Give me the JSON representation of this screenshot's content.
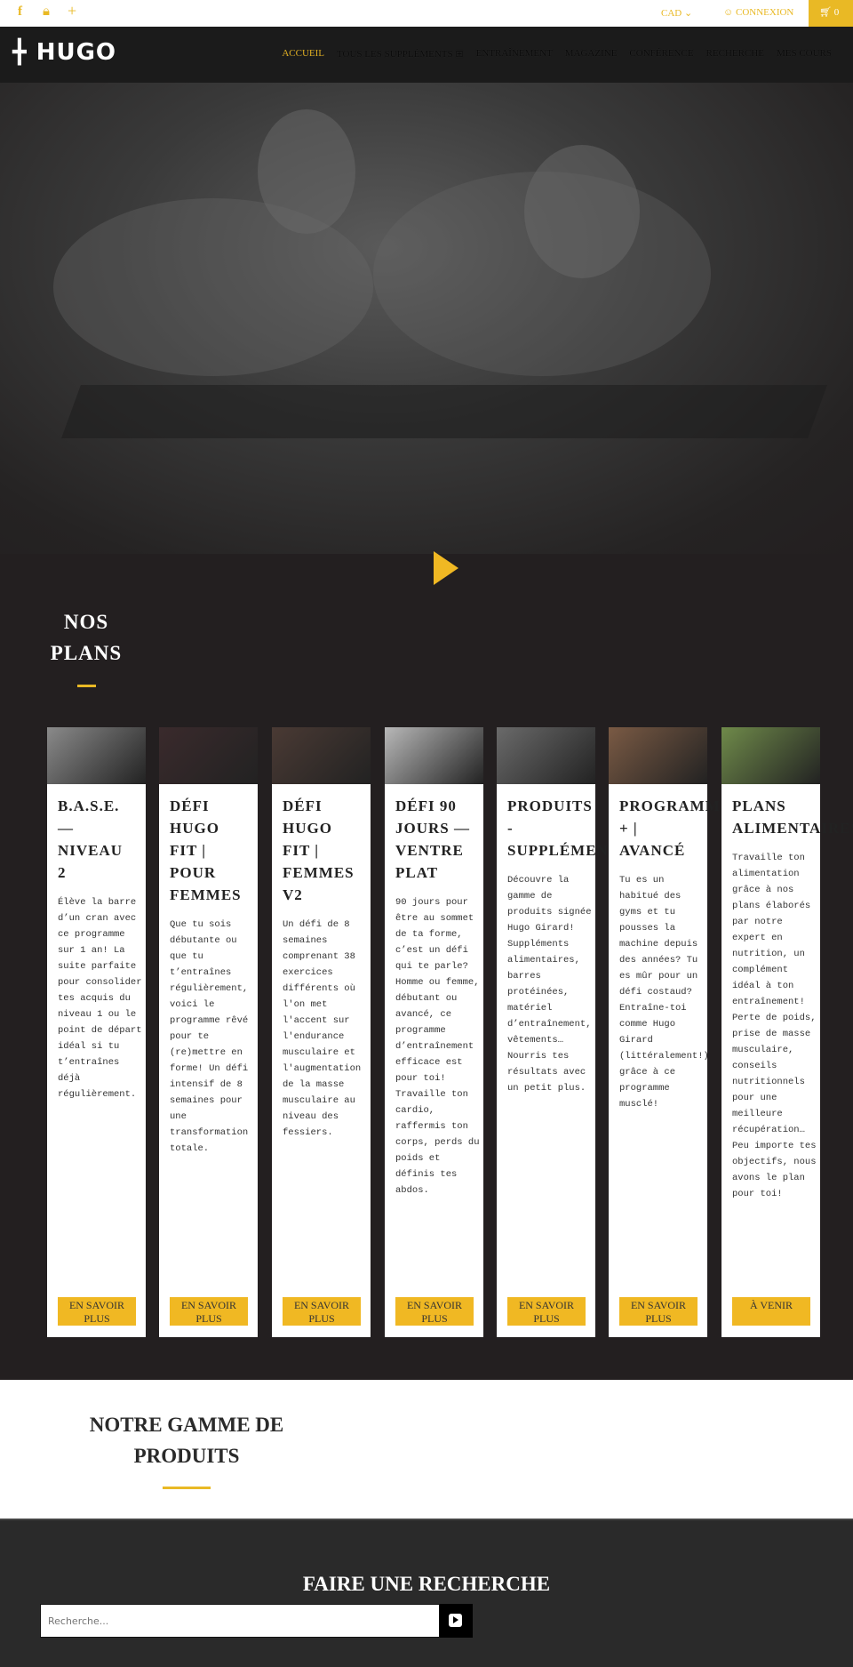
{
  "topbar": {
    "currency": "CAD",
    "login": "CONNEXION",
    "cart_count": "0",
    "icons": [
      "facebook-icon",
      "lock-icon",
      "plus-icon",
      "user-icon",
      "cart-icon"
    ]
  },
  "nav": {
    "logo": "HUGO",
    "items": [
      "ACCUEIL",
      "TOUS LES SUPPLÉMENTS ⊞",
      "ENTRAÎNEMENT",
      "MAGAZINE",
      "CONFÉRENCE",
      "RECHERCHE",
      "MES COURS"
    ]
  },
  "plans": {
    "title_line1": "NOS",
    "title_line2": "PLANS",
    "cards": [
      {
        "title": "B.A.S.E. — NIVEAU 2",
        "text": "Élève la barre d’un cran avec ce programme sur 1 an! La suite parfaite pour consolider tes acquis du niveau 1 ou le point de départ idéal si tu t’entraînes déjà régulièrement.",
        "button": "EN SAVOIR PLUS",
        "image_color": "#8a8a8a"
      },
      {
        "title": "DÉFI HUGO FIT | POUR FEMMES",
        "text": "Que tu sois débutante ou que tu t’entraînes régulièrement, voici le programme rêvé pour te (re)mettre en forme! Un défi intensif de 8 semaines pour une transformation totale.",
        "button": "EN SAVOIR PLUS",
        "image_color": "#3a2a2c"
      },
      {
        "title": "DÉFI HUGO FIT | FEMMES V2",
        "text": "Un défi de 8 semaines comprenant 38 exercices différents où l'on met l'accent sur l'endurance musculaire et l'augmentation de la masse musculaire au niveau des fessiers.",
        "button": "EN SAVOIR PLUS",
        "image_color": "#4a3a34"
      },
      {
        "title": "DÉFI 90 JOURS — VENTRE PLAT",
        "text": "90 jours pour être au sommet de ta forme, c’est un défi qui te parle? Homme ou femme, débutant ou avancé, ce programme d’entraînement efficace est pour toi! Travaille ton cardio, raffermis ton corps, perds du poids et définis tes abdos.",
        "button": "EN SAVOIR PLUS",
        "image_color": "#b8b8b8"
      },
      {
        "title": "PRODUITS - SUPPLÉMENTS",
        "text": "Découvre la gamme de produits signée Hugo Girard! Suppléments alimentaires, barres protéinées, matériel d’entraînement, vêtements… Nourris tes résultats avec un petit plus.",
        "button": "EN SAVOIR PLUS",
        "image_color": "#6a6a6a"
      },
      {
        "title": "PROGRAMME + | AVANCÉ",
        "text": "Tu es un habitué des gyms et tu pousses la machine depuis des années? Tu es mûr pour un défi costaud? Entraîne-toi comme Hugo Girard (littéralement!) grâce à ce programme musclé!",
        "button": "EN SAVOIR PLUS",
        "image_color": "#7a5a44"
      },
      {
        "title": "PLANS ALIMENTAIRES",
        "text": "Travaille ton alimentation grâce à nos plans élaborés par notre expert en nutrition, un complément idéal à ton entraînement! Perte de poids, prise de masse musculaire, conseils nutritionnels pour une meilleure récupération… Peu importe tes objectifs, nous avons le plan pour toi!",
        "button": "À VENIR",
        "image_color": "#6f8a4a"
      }
    ]
  },
  "products": {
    "title_line1": "NOTRE GAMME DE",
    "title_line2": "PRODUITS"
  },
  "search": {
    "title": "FAIRE UNE RECHERCHE",
    "placeholder": "Recherche..."
  },
  "colors": {
    "accent": "#f0b823",
    "dark": "#231f20",
    "nav": "#1b1b1b"
  }
}
